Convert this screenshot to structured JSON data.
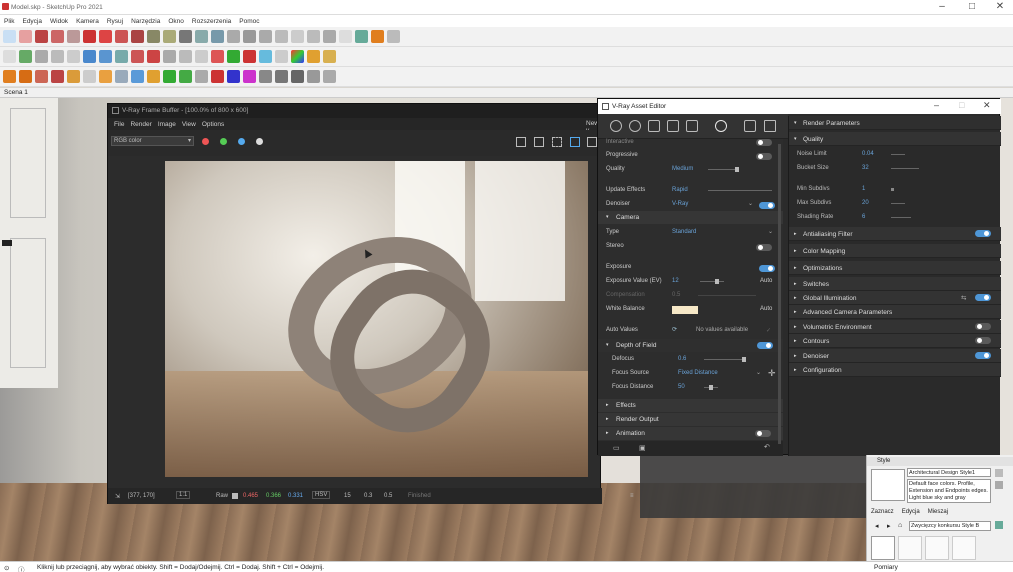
{
  "app": {
    "title": "Model.skp - SketchUp Pro 2021"
  },
  "menu": [
    "Plik",
    "Edycja",
    "Widok",
    "Kamera",
    "Rysuj",
    "Narzędzia",
    "Okno",
    "Rozszerzenia",
    "Pomoc"
  ],
  "scene_tab": "Scena 1",
  "frame_buffer": {
    "title": "V-Ray Frame Buffer - [100.0% of 800 x 600]",
    "menu": [
      "File",
      "Render",
      "Image",
      "View",
      "Options"
    ],
    "extra_label": "New v",
    "channel": "RGB color",
    "status": {
      "coords": "[377, 170]",
      "zoom": "1:1",
      "mode": "Raw",
      "r": "0.465",
      "g": "0.366",
      "b": "0.331",
      "space": "HSV",
      "h": "15",
      "s": "0.3",
      "v": "0.5",
      "state": "Finished"
    }
  },
  "editor": {
    "title": "V-Ray Asset Editor",
    "left_rows": [
      {
        "label": "Interactive"
      },
      {
        "label": "Progressive"
      },
      {
        "label": "Quality",
        "value": "Medium"
      },
      {
        "label": "Update Effects",
        "value": "Rapid"
      },
      {
        "label": "Denoiser",
        "value": "V-Ray"
      },
      {
        "label": "Type",
        "value": "Standard"
      },
      {
        "label": "Stereo"
      },
      {
        "label": "Exposure"
      },
      {
        "label": "Exposure Value (EV)",
        "value": "12",
        "extra": "Auto"
      },
      {
        "label": "Compensation",
        "value": "0.5"
      },
      {
        "label": "White Balance",
        "extra": "Auto"
      },
      {
        "label": "Auto Values",
        "value": "No values available"
      },
      {
        "label": "Defocus",
        "value": "0.6"
      },
      {
        "label": "Focus Source",
        "value": "Fixed Distance"
      },
      {
        "label": "Focus Distance",
        "value": "50"
      }
    ],
    "left_sections": [
      "Camera",
      "Depth of Field",
      "Effects",
      "Render Output",
      "Animation"
    ],
    "render_parameters": "Render Parameters",
    "quality_header": "Quality",
    "quality_rows": [
      {
        "label": "Noise Limit",
        "value": "0.04"
      },
      {
        "label": "Bucket Size",
        "value": "32"
      },
      {
        "label": "Min Subdivs",
        "value": "1"
      },
      {
        "label": "Max Subdivs",
        "value": "20"
      },
      {
        "label": "Shading Rate",
        "value": "6"
      }
    ],
    "right_sections": [
      "Antialiasing Filter",
      "Color Mapping",
      "Optimizations",
      "Switches",
      "Global Illumination",
      "Advanced Camera Parameters",
      "Volumetric Environment",
      "Contours",
      "Denoiser",
      "Configuration"
    ]
  },
  "styles": {
    "header": "Style",
    "name": "Architectural Design Style1",
    "description": "Default face colors. Profile, Extension and Endpoints edges. Light blue sky and gray",
    "tabs": [
      "Zaznacz",
      "Edycja",
      "Mieszaj"
    ],
    "select_value": "Zwycięzcy konkursu Style B",
    "footer": "Pomiary"
  },
  "statusbar": {
    "hint": "Kliknij lub przeciągnij, aby wybrać obiekty. Shift = Dodaj/Odejmij. Ctrl = Dodaj. Shift + Ctrl = Odejmij."
  }
}
